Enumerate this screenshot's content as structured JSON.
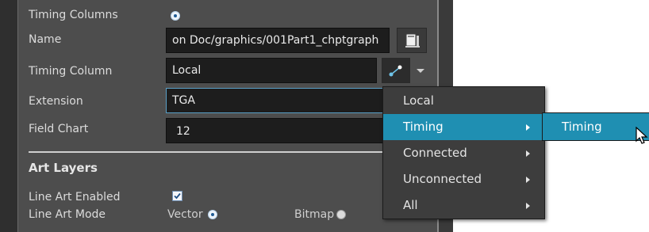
{
  "form": {
    "timing_columns_label": "Timing Columns",
    "name_label": "Name",
    "name_value": "on Doc/graphics/001Part1_chptgraph",
    "timing_column_label": "Timing Column",
    "timing_column_value": "Local",
    "extension_label": "Extension",
    "extension_value": "TGA",
    "field_chart_label": "Field Chart",
    "field_chart_value": "12",
    "art_layers_heading": "Art Layers",
    "line_art_enabled_label": "Line Art Enabled",
    "line_art_mode_label": "Line Art Mode",
    "vector_label": "Vector",
    "bitmap_label": "Bitmap"
  },
  "dropdown_menu": {
    "items": [
      {
        "label": "Local",
        "has_submenu": false
      },
      {
        "label": "Timing",
        "has_submenu": true,
        "highlighted": true
      },
      {
        "label": "Connected",
        "has_submenu": true
      },
      {
        "label": "Unconnected",
        "has_submenu": true
      },
      {
        "label": "All",
        "has_submenu": true
      }
    ]
  },
  "submenu": {
    "items": [
      {
        "label": "Timing",
        "highlighted": true
      }
    ]
  },
  "colors": {
    "panel_bg": "#4d4d4d",
    "field_bg": "#1d1d1d",
    "menu_bg": "#3d3d3d",
    "highlight": "#1f8fb2"
  },
  "icons": [
    "radio-selected-icon",
    "browse-file-icon",
    "connect-nodes-icon",
    "dropdown-arrow-icon",
    "checkbox-checked-icon",
    "radio-unselected-icon",
    "submenu-arrow-icon",
    "mouse-cursor-icon"
  ]
}
